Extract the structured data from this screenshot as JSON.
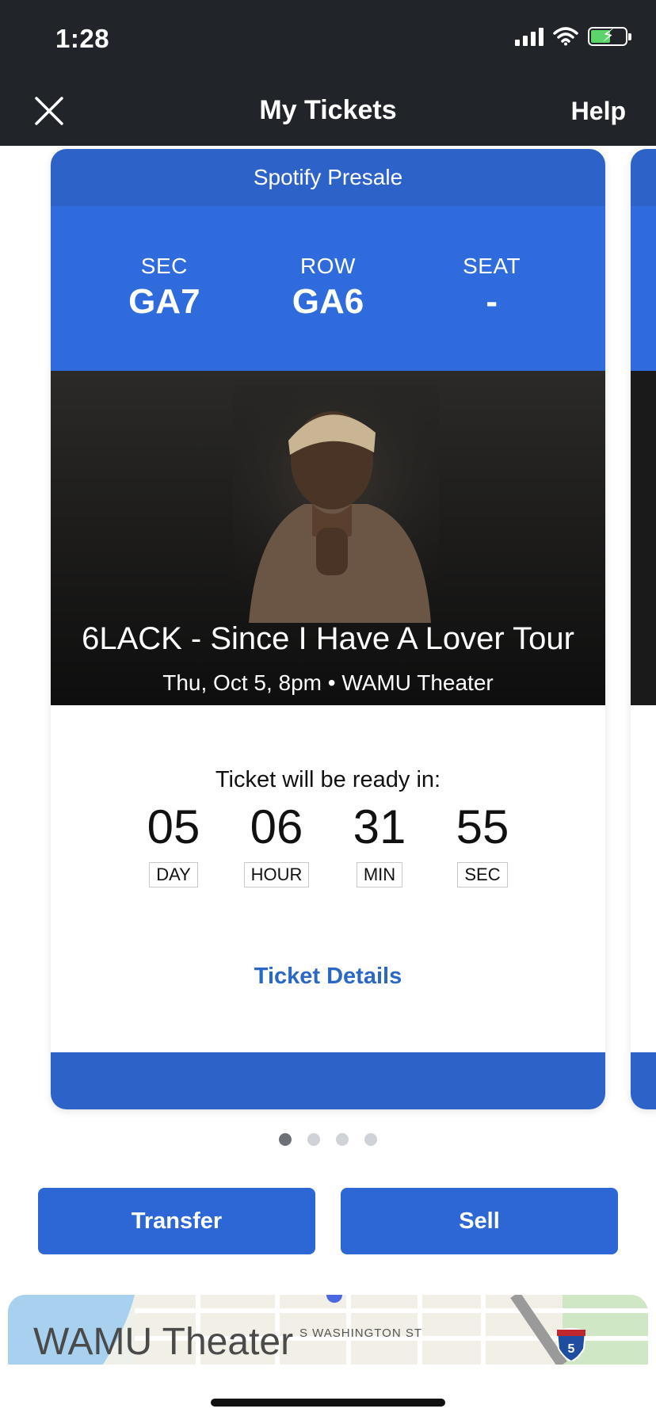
{
  "status_bar": {
    "time": "1:28"
  },
  "nav": {
    "title": "My Tickets",
    "help_label": "Help"
  },
  "ticket": {
    "presale_label": "Spotify Presale",
    "sec_label": "SEC",
    "sec_value": "GA7",
    "row_label": "ROW",
    "row_value": "GA6",
    "seat_label": "SEAT",
    "seat_value": "-",
    "event_name": "6LACK - Since I Have A Lover Tour",
    "event_meta": "Thu, Oct 5, 8pm • WAMU Theater",
    "ready_text": "Ticket will be ready in:",
    "countdown": [
      {
        "value": "05",
        "label": "DAY"
      },
      {
        "value": "06",
        "label": "HOUR"
      },
      {
        "value": "31",
        "label": "MIN"
      },
      {
        "value": "55",
        "label": "SEC"
      }
    ],
    "details_label": "Ticket Details"
  },
  "pager": {
    "count": 4,
    "active": 1
  },
  "actions": {
    "transfer_label": "Transfer",
    "sell_label": "Sell"
  },
  "map": {
    "venue_label": "WAMU Theater",
    "street_label": "S WASHINGTON ST",
    "highway_shield": "5"
  },
  "colors": {
    "brand_blue": "#2d63c9",
    "topbar": "#212429",
    "link_blue": "#2b67c6"
  }
}
